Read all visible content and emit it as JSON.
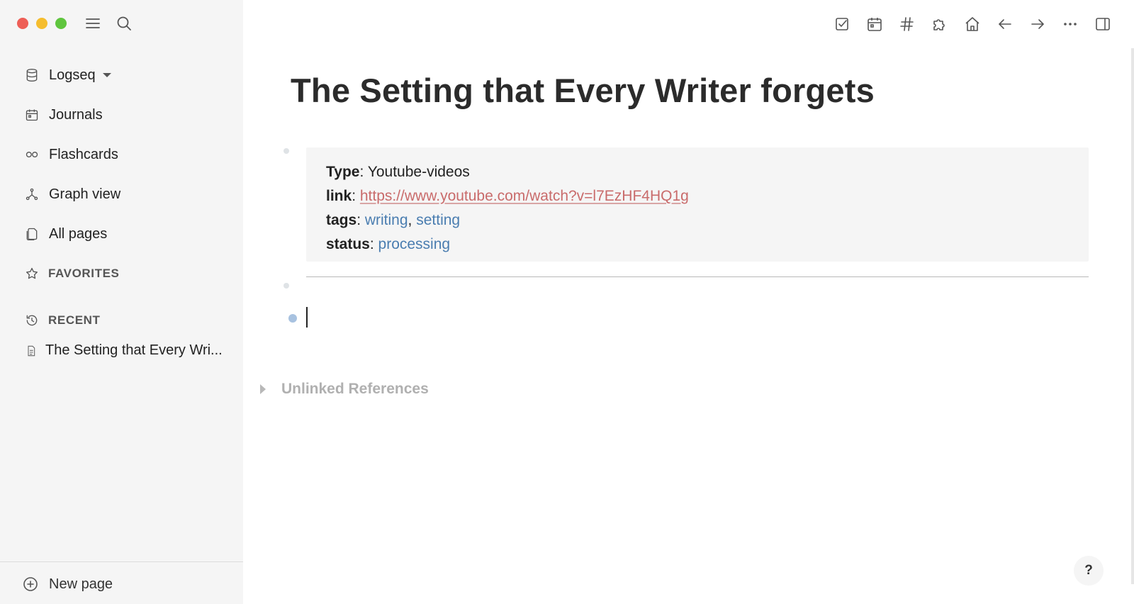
{
  "sidebar": {
    "nav": [
      {
        "label": "Logseq",
        "icon": "database-icon",
        "has_dropdown": true
      },
      {
        "label": "Journals",
        "icon": "calendar-icon"
      },
      {
        "label": "Flashcards",
        "icon": "infinity-icon"
      },
      {
        "label": "Graph view",
        "icon": "graph-icon"
      },
      {
        "label": "All pages",
        "icon": "pages-icon"
      }
    ],
    "favorites_label": "FAVORITES",
    "recent_label": "RECENT",
    "recent_items": [
      "The Setting that Every Wri..."
    ],
    "new_page_label": "New page"
  },
  "toolbar": {
    "icons": [
      "checkbox-icon",
      "calendar-icon",
      "hash-icon",
      "puzzle-icon",
      "home-icon",
      "arrow-left-icon",
      "arrow-right-icon",
      "more-icon",
      "sidebar-toggle-icon"
    ]
  },
  "page": {
    "title": "The Setting that Every Writer forgets",
    "properties": {
      "type_key": "Type",
      "type_value": "Youtube-videos",
      "link_key": "link",
      "link_value": "https://www.youtube.com/watch?v=l7EzHF4HQ1g",
      "tags_key": "tags",
      "tags": [
        "writing",
        "setting"
      ],
      "status_key": "status",
      "status_value": "processing"
    },
    "unlinked_references_label": "Unlinked References"
  },
  "help_label": "?",
  "colors": {
    "link": "#c96b6b",
    "tag": "#4a7db0",
    "sidebar_bg": "#f5f5f5",
    "active_bullet": "#a8c2e0"
  }
}
